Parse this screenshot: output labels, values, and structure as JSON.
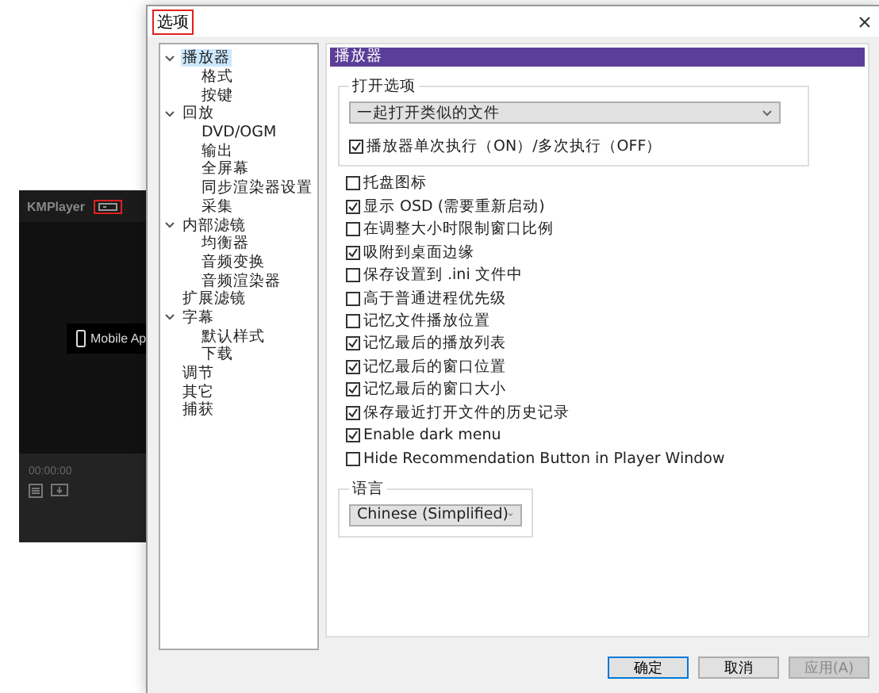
{
  "player_window": {
    "title": "KMPlayer",
    "mobile_button": "Mobile Ap",
    "time": "00:00:00"
  },
  "dialog": {
    "title": "选项",
    "tree": [
      {
        "label": "播放器",
        "selected": true,
        "children": [
          {
            "label": "格式",
            "selected": false
          },
          {
            "label": "按键",
            "selected": false
          }
        ]
      },
      {
        "label": "回放",
        "selected": false,
        "children": [
          {
            "label": "DVD/OGM",
            "selected": false
          },
          {
            "label": "输出",
            "selected": false
          },
          {
            "label": "全屏幕",
            "selected": false
          },
          {
            "label": "同步渲染器设置",
            "selected": false
          },
          {
            "label": "采集",
            "selected": false
          }
        ]
      },
      {
        "label": "内部滤镜",
        "selected": false,
        "children": [
          {
            "label": "均衡器",
            "selected": false
          },
          {
            "label": "音频变换",
            "selected": false
          },
          {
            "label": "音频渲染器",
            "selected": false
          }
        ]
      },
      {
        "label": "扩展滤镜",
        "selected": false
      },
      {
        "label": "字幕",
        "selected": false,
        "children": [
          {
            "label": "默认样式",
            "selected": false
          },
          {
            "label": "下载",
            "selected": false
          }
        ]
      },
      {
        "label": "调节",
        "selected": false
      },
      {
        "label": "其它",
        "selected": false
      },
      {
        "label": "捕获",
        "selected": false
      }
    ],
    "section_title": "播放器",
    "open_group": {
      "label": "打开选项",
      "dropdown": "一起打开类似的文件",
      "checkbox": {
        "label": "播放器单次执行（ON）/多次执行（OFF）",
        "checked": true
      }
    },
    "options": [
      {
        "label": "托盘图标",
        "checked": false
      },
      {
        "label": "显示 OSD (需要重新启动)",
        "checked": true
      },
      {
        "label": "在调整大小时限制窗口比例",
        "checked": false
      },
      {
        "label": "吸附到桌面边缘",
        "checked": true
      },
      {
        "label": "保存设置到 .ini 文件中",
        "checked": false
      },
      {
        "label": "高于普通进程优先级",
        "checked": false
      },
      {
        "label": "记忆文件播放位置",
        "checked": false
      },
      {
        "label": "记忆最后的播放列表",
        "checked": true
      },
      {
        "label": "记忆最后的窗口位置",
        "checked": true
      },
      {
        "label": "记忆最后的窗口大小",
        "checked": true
      },
      {
        "label": "保存最近打开文件的历史记录",
        "checked": true
      },
      {
        "label": "Enable dark menu",
        "checked": true
      },
      {
        "label": "Hide Recommendation Button in Player Window",
        "checked": false
      }
    ],
    "language_group": {
      "label": "语言",
      "dropdown": "Chinese (Simplified)"
    },
    "buttons": [
      {
        "label": "确定",
        "disabled": false,
        "kind": "default"
      },
      {
        "label": "取消",
        "disabled": false,
        "kind": "normal"
      },
      {
        "label": "应用(A)",
        "disabled": true,
        "kind": "normal"
      }
    ]
  }
}
